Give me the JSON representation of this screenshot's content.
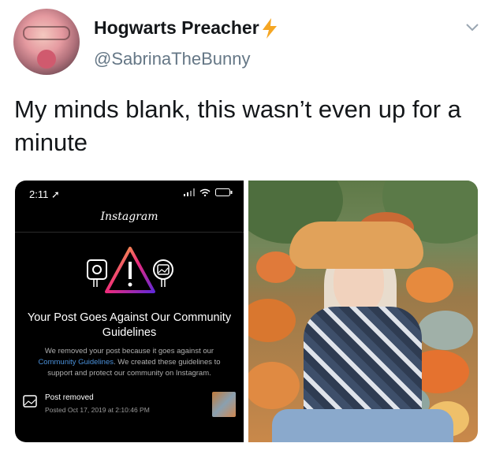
{
  "tweet": {
    "display_name": "Hogwarts Preacher",
    "handle": "@SabrinaTheBunny",
    "text": "My minds blank, this wasn’t even up for a minute",
    "icons": [
      "lightning-bolt-emoji",
      "chevron-down-icon"
    ]
  },
  "media": {
    "screenshot": {
      "status_time": "2:11",
      "app_title": "Instagram",
      "notice_title": "Your Post Goes Against Our Community Guidelines",
      "notice_body_start": "We removed your post because it goes against our ",
      "notice_body_link": "Community Guidelines",
      "notice_body_end": ". We created these guidelines to support and protect our community on Instagram.",
      "removed_title": "Post removed",
      "removed_date": "Posted Oct 17, 2019 at 2:10:46 PM"
    }
  },
  "colors": {
    "name_text": "#14171a",
    "handle_text": "#657786",
    "link_blue": "#4a90d9",
    "bolt": "#f5a623"
  }
}
